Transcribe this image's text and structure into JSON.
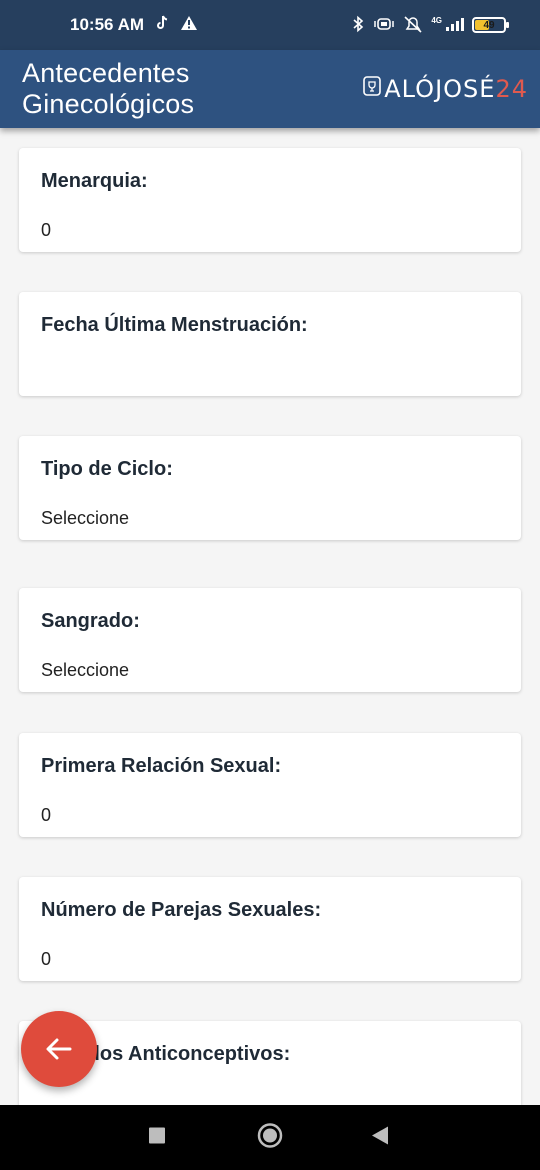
{
  "status_bar": {
    "time": "10:56 AM",
    "network": "4G",
    "battery": "49"
  },
  "app_bar": {
    "title": "Antecedentes Ginecológicos",
    "logo_main": "ALÓJOSÉ",
    "logo_accent": "24"
  },
  "fields": [
    {
      "label": "Menarquia:",
      "value": "0"
    },
    {
      "label": "Fecha Última Menstruación:",
      "value": ""
    },
    {
      "label": "Tipo de Ciclo:",
      "value": "Seleccione"
    },
    {
      "label": "Sangrado:",
      "value": "Seleccione"
    },
    {
      "label": "Primera Relación Sexual:",
      "value": "0"
    },
    {
      "label": "Número de Parejas Sexuales:",
      "value": "0"
    },
    {
      "label": "Métodos Anticonceptivos:",
      "value": ""
    }
  ],
  "colors": {
    "app_bar": "#2e5280",
    "status_bar": "#263f5e",
    "fab": "#df4b3c",
    "logo_accent": "#e05a4f"
  }
}
